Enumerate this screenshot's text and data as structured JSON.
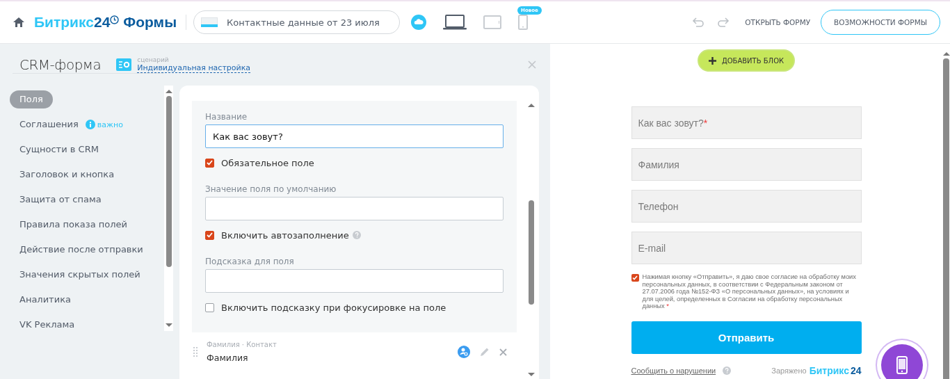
{
  "header": {
    "logo": {
      "brand": "Битрикс",
      "number": "24",
      "product": "Формы"
    },
    "form_name": {
      "value": "Контактные данные от 23 июля"
    },
    "devices": [
      {
        "kind": "cloud",
        "selected": false
      },
      {
        "kind": "laptop",
        "selected": true
      },
      {
        "kind": "tablet",
        "selected": false
      },
      {
        "kind": "phone",
        "selected": false,
        "badge": "Новое"
      }
    ],
    "undo_disabled": true,
    "redo_disabled": true,
    "open_form": "ОТКРЫТЬ ФОРМУ",
    "features_button": "ВОЗМОЖНОСТИ ФОРМЫ"
  },
  "editor": {
    "title": "CRM-форма",
    "scenario_label": "сценарий",
    "scenario": "Индивидуальная настройка",
    "sidebar": {
      "items": [
        {
          "label": "Поля",
          "selected": true
        },
        {
          "label": "Соглашения",
          "selected": false,
          "badge": "важно"
        },
        {
          "label": "Сущности в CRM",
          "selected": false
        },
        {
          "label": "Заголовок и кнопка",
          "selected": false
        },
        {
          "label": "Защита от спама",
          "selected": false
        },
        {
          "label": "Правила показа полей",
          "selected": false
        },
        {
          "label": "Действие после отправки",
          "selected": false
        },
        {
          "label": "Значения скрытых полей",
          "selected": false
        },
        {
          "label": "Аналитика",
          "selected": false
        },
        {
          "label": "VK Реклама",
          "selected": false
        }
      ]
    },
    "field_settings": [
      {
        "kind": "text",
        "label": "Название",
        "value": "Как вас зовут?"
      },
      {
        "kind": "checkbox",
        "label": "Обязательное поле",
        "checked": true
      },
      {
        "kind": "text",
        "label": "Значение поля по умолчанию"
      },
      {
        "kind": "checkbox",
        "label": "Включить автозаполнение",
        "checked": true,
        "help": true
      },
      {
        "kind": "text",
        "label": "Подсказка для поля"
      },
      {
        "kind": "checkbox",
        "label": "Включить подсказку при фокусировке на поле",
        "checked": false
      }
    ],
    "next_field": {
      "meta": "Фамилия · Контакт",
      "name": "Фамилия"
    }
  },
  "preview": {
    "add_block": "ДОБАВИТЬ БЛОК",
    "fields": [
      {
        "placeholder": "Как вас зовут?",
        "required_mark": "*"
      },
      {
        "placeholder": "Фамилия"
      },
      {
        "placeholder": "Телефон"
      },
      {
        "placeholder": "E-mail"
      }
    ],
    "consent": {
      "checked": true,
      "text": "Нажимая кнопку «Отправить», я даю свое согласие на обработку моих персональных данных, в соответствии с Федеральным законом от 27.07.2006 года №152-ФЗ «О персональных данных», на условиях и для целей, определенных в Согласии на обработку персональных данных",
      "required_mark": "*"
    },
    "submit": "Отправить",
    "report": "Сообщить о нарушении",
    "powered": "Заряжено",
    "powered_brand": "Битрикс",
    "powered_number": "24"
  }
}
